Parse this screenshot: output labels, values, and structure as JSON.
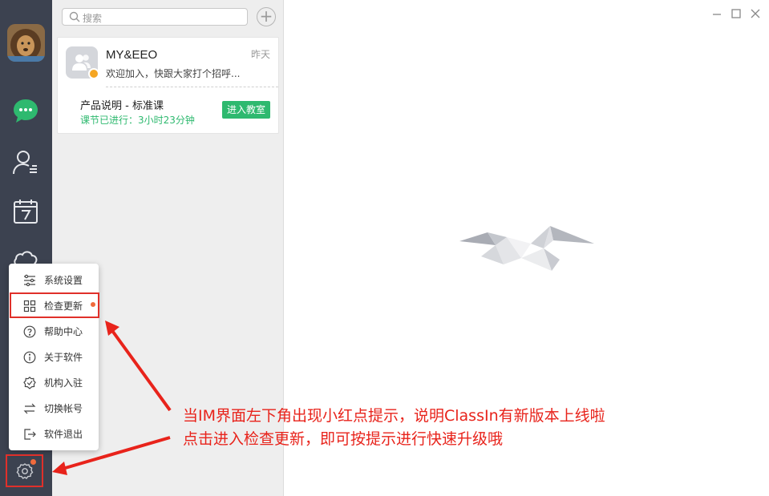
{
  "search": {
    "placeholder": "搜索"
  },
  "conversation": {
    "name": "MY&EEO",
    "time": "昨天",
    "last_message": "欢迎加入，快跟大家打个招呼...",
    "course_title": "产品说明 - 标准课",
    "course_status": "课节已进行：3小时23分钟",
    "enter_button": "进入教室"
  },
  "menu": {
    "items": [
      {
        "label": "系统设置",
        "icon": "sliders-icon"
      },
      {
        "label": "检查更新",
        "icon": "grid-icon",
        "highlighted": true,
        "has_red_dot": true
      },
      {
        "label": "帮助中心",
        "icon": "help-icon"
      },
      {
        "label": "关于软件",
        "icon": "info-icon"
      },
      {
        "label": "机构入驻",
        "icon": "badge-icon"
      },
      {
        "label": "切换帐号",
        "icon": "switch-icon"
      },
      {
        "label": "软件退出",
        "icon": "exit-icon"
      }
    ]
  },
  "annotation": {
    "line1": "当IM界面左下角出现小红点提示，说明ClassIn有新版本上线啦",
    "line2": "点击进入检查更新，即可按提示进行快速升级哦"
  },
  "colors": {
    "rail_bg": "#3c4250",
    "accent_green": "#2eb96f",
    "highlight_red": "#e0302a",
    "dot_orange": "#f06a3c"
  }
}
